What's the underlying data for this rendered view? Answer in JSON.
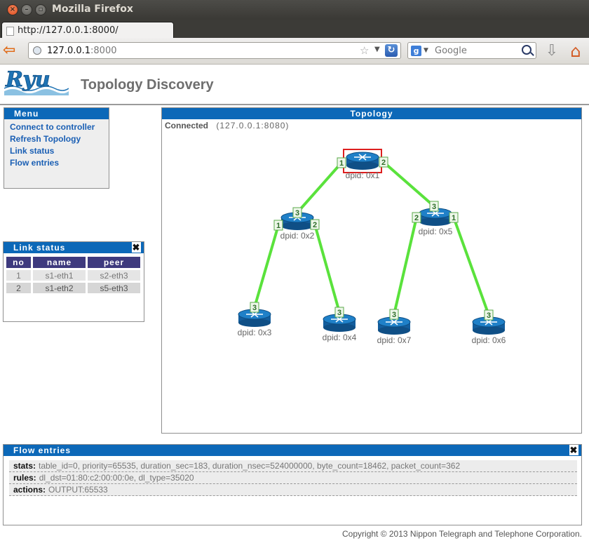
{
  "window": {
    "title": "Mozilla Firefox"
  },
  "tab": {
    "label": "http://127.0.0.1:8000/"
  },
  "urlbar": {
    "host": "127.0.0.1",
    "port": ":8000"
  },
  "search": {
    "engine": "g",
    "placeholder": "Google"
  },
  "page": {
    "title": "Topology Discovery",
    "logo_text": "Ryu"
  },
  "menu": {
    "title": "Menu",
    "items": [
      "Connect to controller",
      "Refresh Topology",
      "Link status",
      "Flow entries"
    ]
  },
  "link_status": {
    "title": "Link status",
    "close": "✖",
    "columns": [
      "no",
      "name",
      "peer"
    ],
    "rows": [
      {
        "no": "1",
        "name": "s1-eth1",
        "peer": "s2-eth3"
      },
      {
        "no": "2",
        "name": "s1-eth2",
        "peer": "s5-eth3"
      }
    ]
  },
  "topology": {
    "title": "Topology",
    "connection_label": "Connected",
    "connection_addr": "(127.0.0.1:8080)",
    "switches": [
      {
        "label": "dpid: 0x1",
        "selected": true,
        "ports": [
          "1",
          "2"
        ]
      },
      {
        "label": "dpid: 0x2",
        "selected": false,
        "ports": [
          "1",
          "3",
          "2"
        ]
      },
      {
        "label": "dpid: 0x5",
        "selected": false,
        "ports": [
          "2",
          "3",
          "1"
        ]
      },
      {
        "label": "dpid: 0x3",
        "selected": false,
        "ports": [
          "3"
        ]
      },
      {
        "label": "dpid: 0x4",
        "selected": false,
        "ports": [
          "3"
        ]
      },
      {
        "label": "dpid: 0x7",
        "selected": false,
        "ports": [
          "3"
        ]
      },
      {
        "label": "dpid: 0x6",
        "selected": false,
        "ports": [
          "3"
        ]
      }
    ],
    "link_color": "#5ae23c",
    "switch_color": "#1f80c8",
    "selection_color": "#dd1f1f"
  },
  "flow_entries": {
    "title": "Flow entries",
    "close": "✖",
    "rows": [
      {
        "key": "stats:",
        "value": "table_id=0, priority=65535, duration_sec=183, duration_nsec=524000000, byte_count=18462, packet_count=362"
      },
      {
        "key": "rules:",
        "value": "dl_dst=01:80:c2:00:00:0e, dl_type=35020"
      },
      {
        "key": "actions:",
        "value": "OUTPUT:65533"
      }
    ]
  },
  "footer": {
    "copyright": "Copyright © 2013 Nippon Telegraph and Telephone Corporation."
  },
  "colors": {
    "panel_header": "#0c68b8",
    "menu_link": "#1a5fb4",
    "table_header": "#3e3a7e"
  }
}
